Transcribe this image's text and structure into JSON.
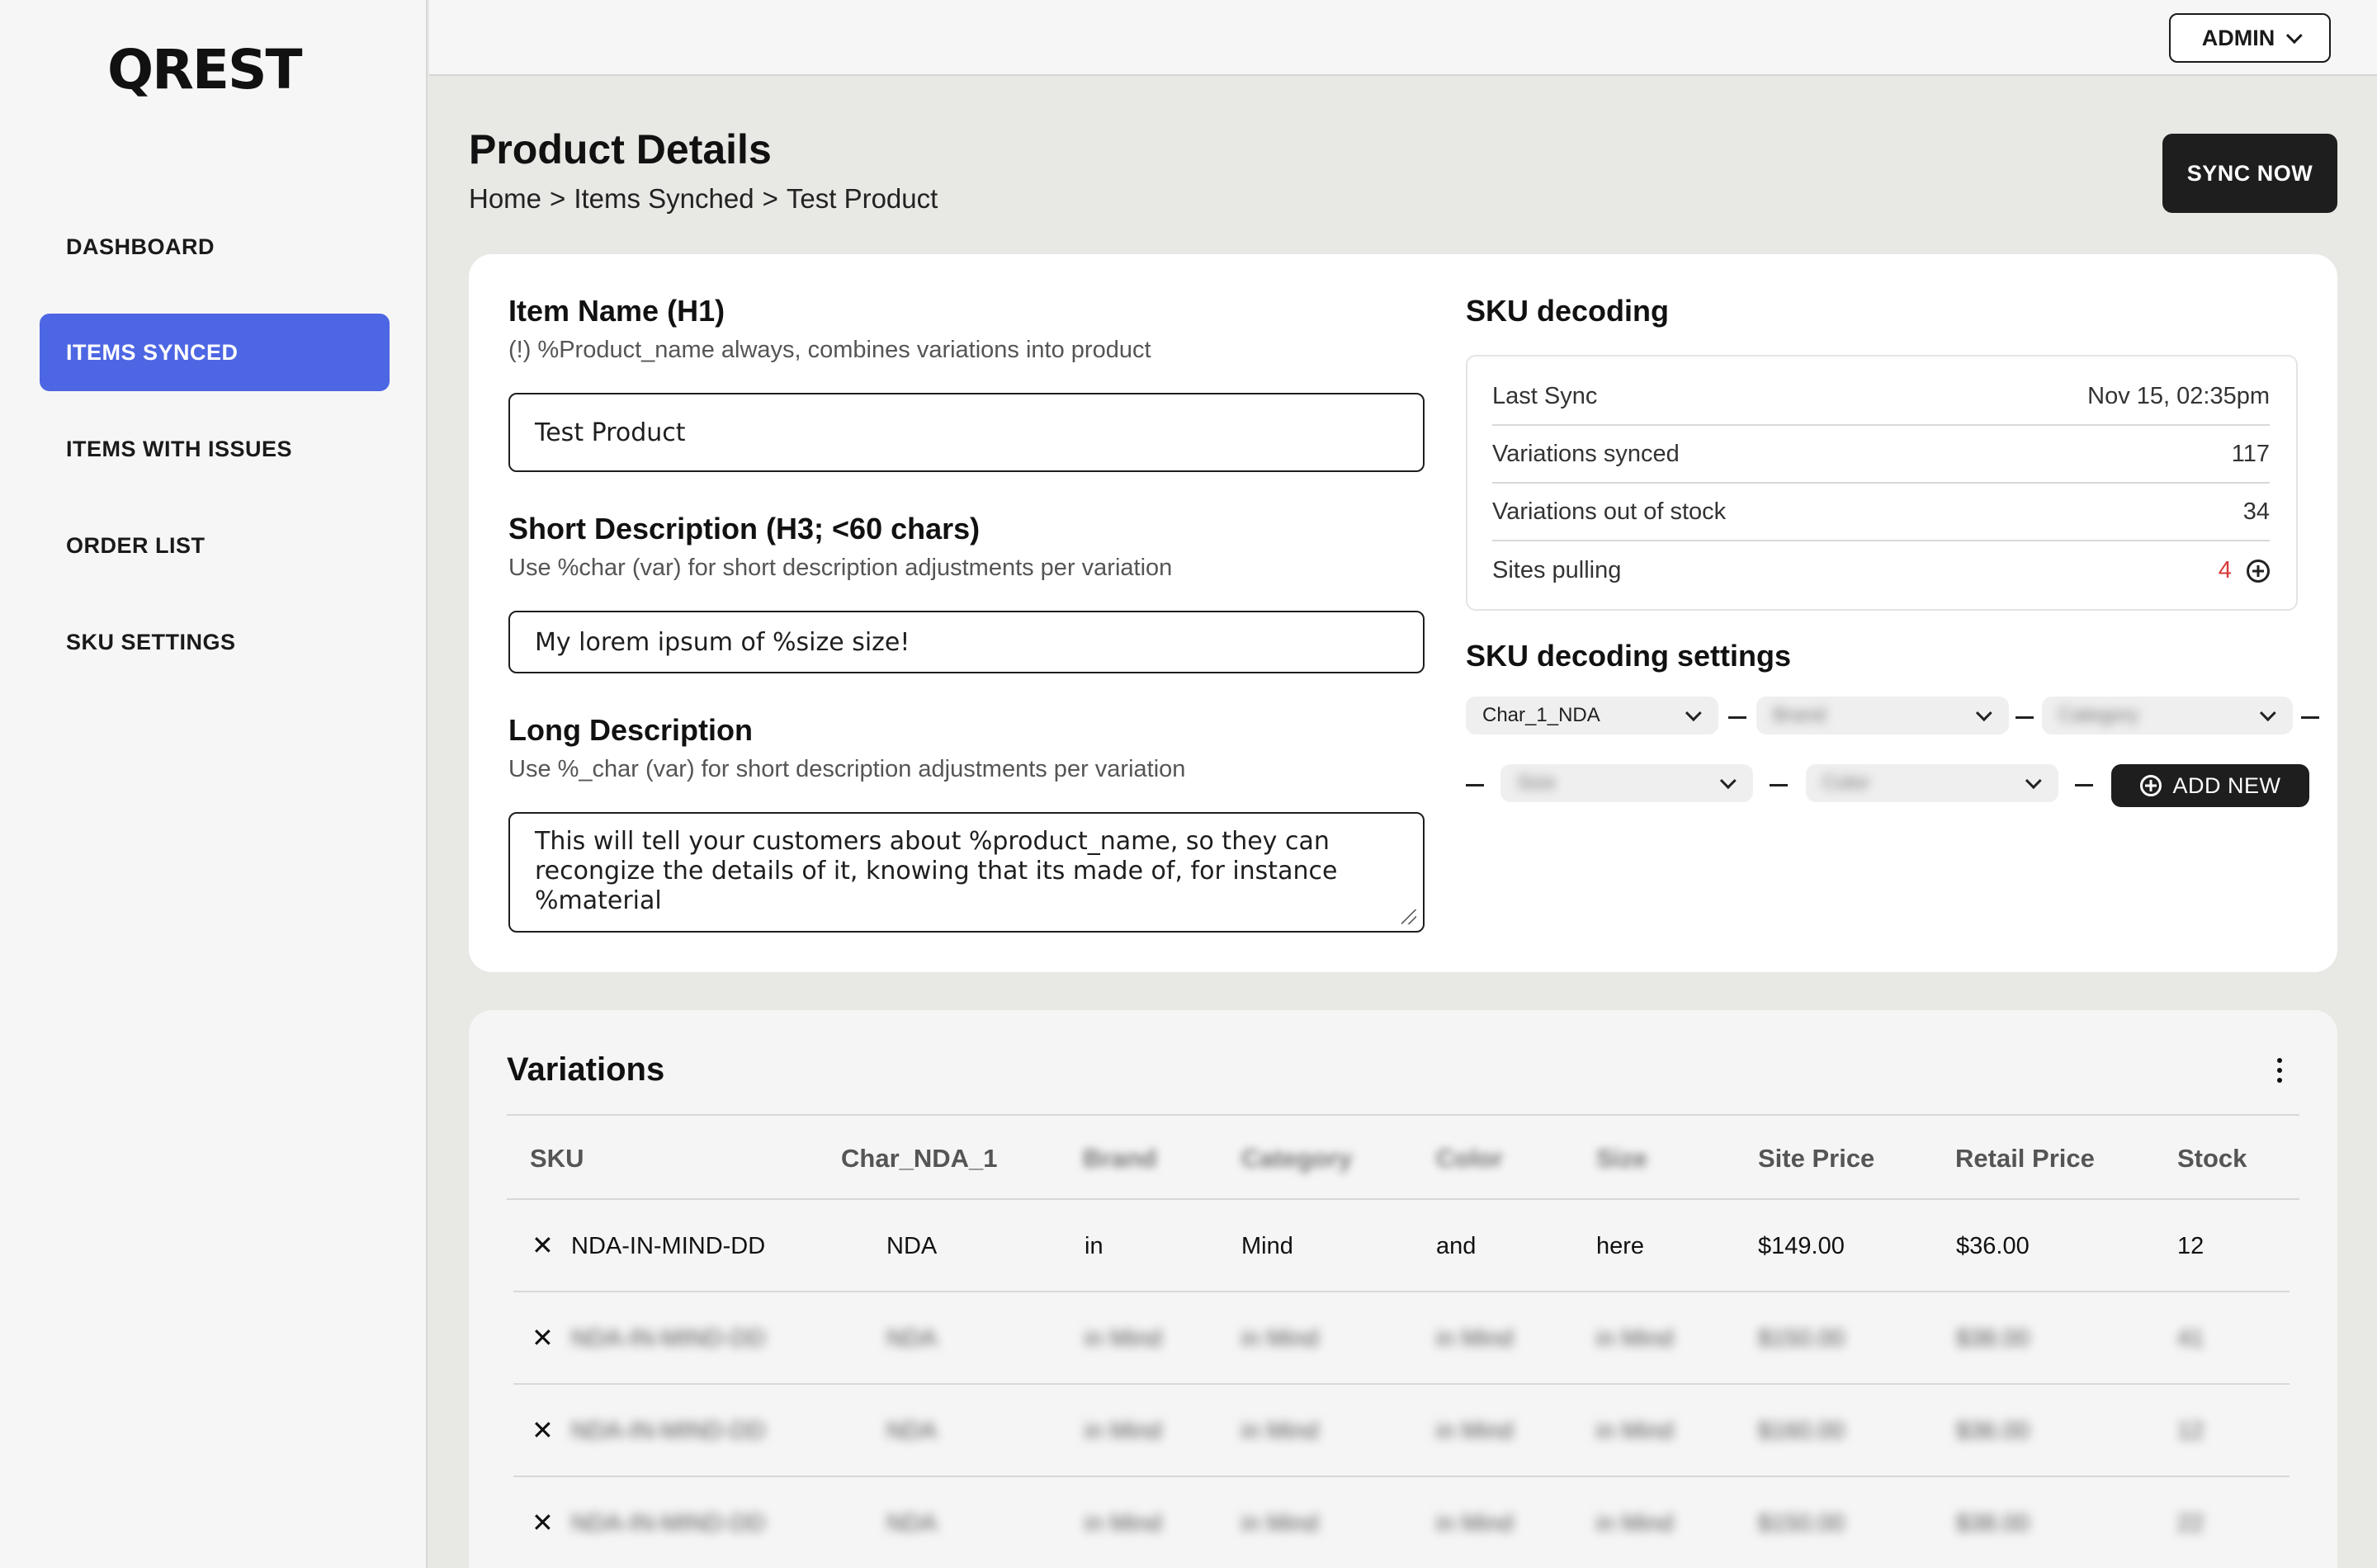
{
  "app": {
    "logo": "QREST"
  },
  "sidebar": {
    "items": [
      {
        "label": "DASHBOARD",
        "active": false
      },
      {
        "label": "ITEMS SYNCED",
        "active": true
      },
      {
        "label": "ITEMS WITH ISSUES",
        "active": false
      },
      {
        "label": "ORDER LIST",
        "active": false
      },
      {
        "label": "SKU SETTINGS",
        "active": false
      }
    ]
  },
  "topbar": {
    "user_menu": "ADMIN"
  },
  "header": {
    "title": "Product Details",
    "breadcrumb": [
      "Home",
      ">",
      "Items Synched",
      ">",
      "Test Product"
    ],
    "sync_button": "SYNC NOW"
  },
  "form": {
    "item_name": {
      "title": "Item Name (H1)",
      "hint": "(!) %Product_name always, combines variations into product",
      "value": "Test Product"
    },
    "short_desc": {
      "title": "Short Description (H3; <60 chars)",
      "hint": "Use %char (var) for short description adjustments per variation",
      "value": "My lorem ipsum of %size size!"
    },
    "long_desc": {
      "title": "Long Description",
      "hint": "Use %_char (var) for short description adjustments per variation",
      "value": "This will tell your customers about %product_name, so they can recongize the details of it, knowing that its made of, for instance %material"
    }
  },
  "sku_decoding": {
    "title": "SKU decoding",
    "rows": [
      {
        "label": "Last Sync",
        "value": "Nov 15, 02:35pm"
      },
      {
        "label": "Variations synced",
        "value": "117"
      },
      {
        "label": "Variations out of stock",
        "value": "34"
      },
      {
        "label": "Sites pulling",
        "value": "4"
      }
    ],
    "status_color": "#d93a3a"
  },
  "sku_settings": {
    "title": "SKU decoding settings",
    "dropdowns": [
      "Char_1_NDA",
      "Brand",
      "Category",
      "Size",
      "Color"
    ],
    "add_button": "ADD NEW"
  },
  "variations": {
    "title": "Variations",
    "columns": [
      "SKU",
      "Char_NDA_1",
      "Brand",
      "Category",
      "Color",
      "Size",
      "Site Price",
      "Retail Price",
      "Stock"
    ],
    "rows": [
      [
        "NDA-IN-MIND-DD",
        "NDA",
        "in",
        "Mind",
        "and",
        "here",
        "$149.00",
        "$36.00",
        "12"
      ],
      [
        "NDA-IN-MIND-DD",
        "NDA",
        "in Mind",
        "in Mind",
        "in Mind",
        "in Mind",
        "$150.00",
        "$38.00",
        "41"
      ],
      [
        "NDA-IN-MIND-DD",
        "NDA",
        "in Mind",
        "in Mind",
        "in Mind",
        "in Mind",
        "$160.00",
        "$36.00",
        "12"
      ],
      [
        "NDA-IN-MIND-DD",
        "NDA",
        "in Mind",
        "in Mind",
        "in Mind",
        "in Mind",
        "$150.00",
        "$38.00",
        "22"
      ]
    ]
  },
  "colors": {
    "accent": "#4d66e3",
    "dark_button": "#1e1e1e",
    "background": "#e8e8e4"
  }
}
